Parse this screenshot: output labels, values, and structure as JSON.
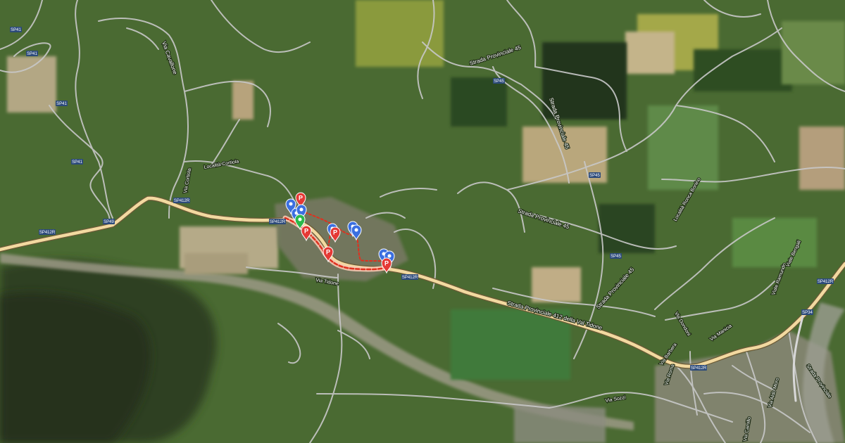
{
  "map": {
    "basemap": "satellite",
    "colors": {
      "main_road": "#f2d9a0",
      "minor_road": "#c8c8c8",
      "shield": "#2c4a7a",
      "route": "#e0301e",
      "route_casing": "#f7c6b0",
      "pin_blue": "#3b6fe0",
      "pin_red": "#e53935",
      "pin_green": "#2bb84a"
    },
    "road_labels": {
      "via_cavallone": "Via Cavallone",
      "strada_prov_45_top": "Strada Provinciale 45",
      "strada_prov_45_right": "Strada Provinciale 45",
      "strada_prov_45_mid": "Strada Provinciale 45",
      "strada_prov_45_low": "Strada Provinciale 45",
      "strada_prov_412": "Strada Provinciale 412 della Val Tidone",
      "via_cortiola": "Via Cortiola",
      "localita_cortiola": "Località Cortiola",
      "localita_ronca": "Località Ronca Bonino",
      "via_tidone": "Via Tidone",
      "via_barbera": "Via Barbera",
      "via_roma": "Via Roma",
      "via_sozzi": "Via Sozzi",
      "via_manicia": "Via Manicia",
      "via_ramundo": "Viale Ramundo",
      "viale_bengali": "Viale Bengali",
      "strada_provinciale_br": "Strada Provinciale",
      "via_aldo_moro": "Via Aldo Moro",
      "via_camillo": "Via Camillo",
      "via_dondoni": "Via Dondoni"
    },
    "shields": {
      "sp41_a": "SP41",
      "sp41_b": "SP41",
      "sp41_c": "SP41",
      "sp41_d": "SP41",
      "sp412r_left": "SP412R",
      "sp412r_mid": "SP412R",
      "sp412r_center": "SP412R",
      "sp412r_right": "SP412R",
      "sp412r_far": "SP412R",
      "sp45_a": "SP45",
      "sp45_b": "SP45",
      "sp45_c": "SP45",
      "sp34": "SP34",
      "sp49": "SP49"
    },
    "markers": [
      {
        "id": "pin-blue-1",
        "type": "location",
        "color": "blue",
        "letter": ""
      },
      {
        "id": "pin-red-p-1",
        "type": "parking",
        "color": "red",
        "letter": "P"
      },
      {
        "id": "pin-blue-2",
        "type": "location",
        "color": "blue",
        "letter": ""
      },
      {
        "id": "pin-blue-3",
        "type": "location",
        "color": "blue",
        "letter": ""
      },
      {
        "id": "pin-green-1",
        "type": "start",
        "color": "green",
        "letter": ""
      },
      {
        "id": "pin-red-p-2",
        "type": "parking",
        "color": "red",
        "letter": "P"
      },
      {
        "id": "pin-blue-4",
        "type": "location",
        "color": "blue",
        "letter": ""
      },
      {
        "id": "pin-red-p-3",
        "type": "parking",
        "color": "red",
        "letter": "P"
      },
      {
        "id": "pin-blue-5",
        "type": "location",
        "color": "blue",
        "letter": ""
      },
      {
        "id": "pin-blue-6",
        "type": "location",
        "color": "blue",
        "letter": ""
      },
      {
        "id": "pin-red-p-4",
        "type": "parking",
        "color": "red",
        "letter": "P"
      },
      {
        "id": "pin-blue-7",
        "type": "location",
        "color": "blue",
        "letter": ""
      },
      {
        "id": "pin-blue-8",
        "type": "location",
        "color": "blue",
        "letter": ""
      },
      {
        "id": "pin-red-p-5",
        "type": "parking",
        "color": "red",
        "letter": "P"
      }
    ]
  }
}
